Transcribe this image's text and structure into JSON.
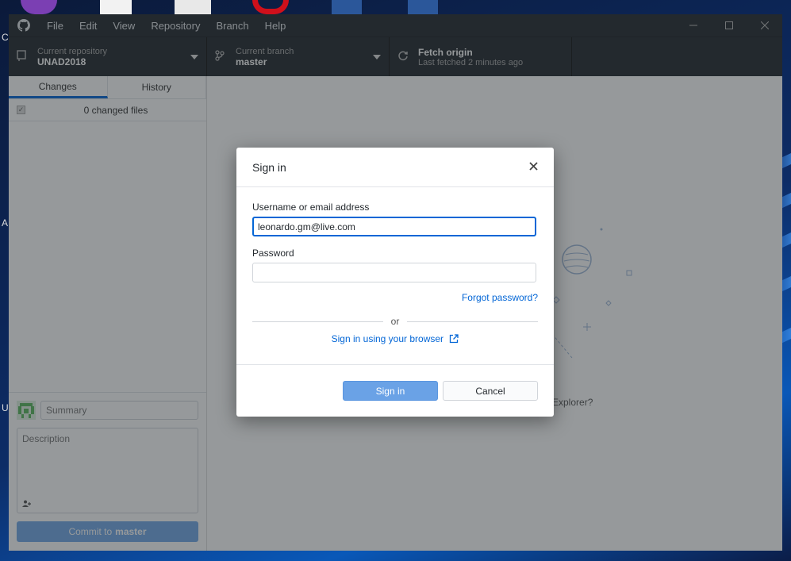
{
  "menu": {
    "file": "File",
    "edit": "Edit",
    "view": "View",
    "repository": "Repository",
    "branch": "Branch",
    "help": "Help"
  },
  "toolbar": {
    "repo_label": "Current repository",
    "repo_value": "UNAD2018",
    "branch_label": "Current branch",
    "branch_value": "master",
    "fetch_title": "Fetch origin",
    "fetch_sub": "Last fetched 2 minutes ago"
  },
  "sidebar": {
    "tabs": [
      "Changes",
      "History"
    ],
    "changed_files": "0 changed files",
    "summary_placeholder": "Summary",
    "description_placeholder": "Description",
    "commit_prefix": "Commit to",
    "commit_branch": "master"
  },
  "main": {
    "explorer_fragment": "n Explorer?"
  },
  "dialog": {
    "title": "Sign in",
    "username_label": "Username or email address",
    "username_value": "leonardo.gm@live.com",
    "password_label": "Password",
    "password_value": "",
    "forgot": "Forgot password?",
    "or": "or",
    "browser_link": "Sign in using your browser",
    "sign_in_button": "Sign in",
    "cancel_button": "Cancel"
  },
  "desktop": {
    "edge_letters": [
      "C",
      "A",
      "U"
    ]
  },
  "colors": {
    "titlebar": "#24292e",
    "accent": "#0366d6",
    "primary_button": "#6aa2e6"
  }
}
